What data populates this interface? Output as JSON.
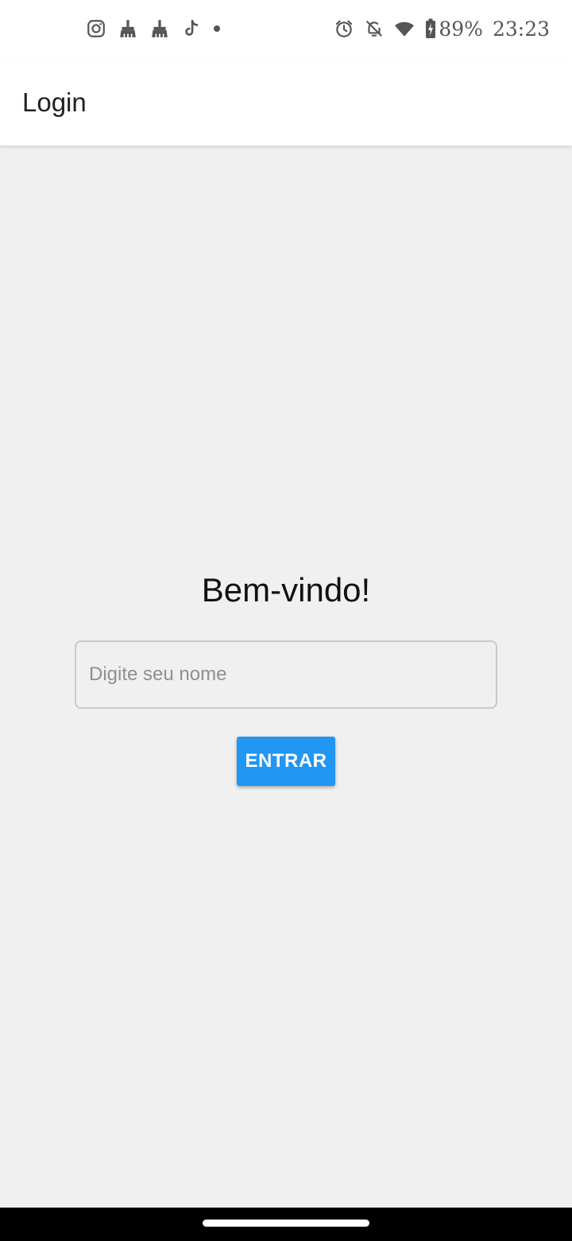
{
  "status_bar": {
    "left_icons": [
      "instagram-icon",
      "cleaner-icon",
      "cleaner-icon",
      "tiktok-icon",
      "dot-icon"
    ],
    "right_icons": [
      "alarm-icon",
      "notifications-off-icon",
      "wifi-icon",
      "battery-charging-icon"
    ],
    "battery_level": "89%",
    "clock": "23:23"
  },
  "app_bar": {
    "title": "Login"
  },
  "login": {
    "welcome": "Bem-vindo!",
    "name_input": {
      "placeholder": "Digite seu nome",
      "value": ""
    },
    "enter_label": "ENTRAR"
  },
  "colors": {
    "primary": "#2196f3",
    "background": "#f0f0f0",
    "app_bar": "#ffffff",
    "nav_bar": "#000000"
  }
}
